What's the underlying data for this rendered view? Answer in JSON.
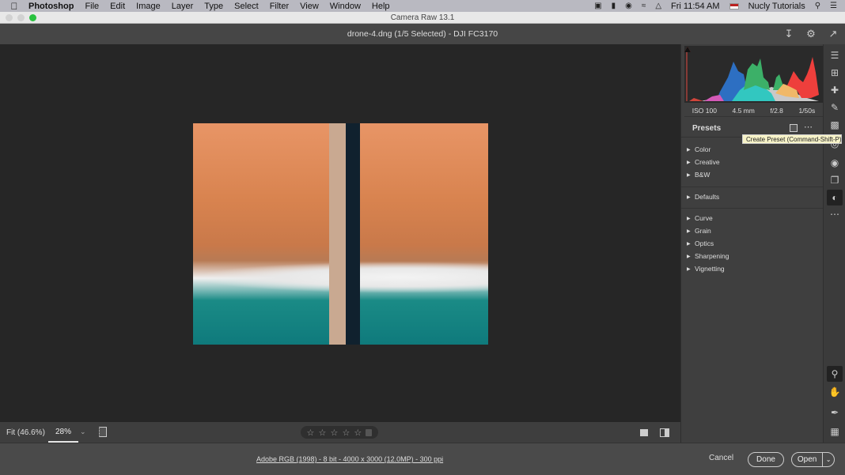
{
  "menubar": {
    "app": "Photoshop",
    "items": [
      "File",
      "Edit",
      "Image",
      "Layer",
      "Type",
      "Select",
      "Filter",
      "View",
      "Window",
      "Help"
    ],
    "clock": "Fri 11:54 AM",
    "user": "Nucly Tutorials"
  },
  "window": {
    "title": "Camera Raw 13.1"
  },
  "header": {
    "file_info": "drone-4.dng (1/5 Selected)  -  DJI FC3170"
  },
  "histogram": {
    "exif": [
      "ISO 100",
      "4.5 mm",
      "f/2.8",
      "1/50s"
    ]
  },
  "presets": {
    "title": "Presets",
    "tooltip": "Create Preset (Command-Shift-P)",
    "groups": [
      [
        "Color",
        "Creative",
        "B&W"
      ],
      [
        "Defaults"
      ],
      [
        "Curve",
        "Grain",
        "Optics",
        "Sharpening",
        "Vignetting"
      ]
    ]
  },
  "bottom": {
    "fit_label": "Fit (46.6%)",
    "zoom_value": "28%",
    "rating_stars": 0
  },
  "footer": {
    "info": "Adobe RGB (1998) - 8 bit - 4000 x 3000 (12.0MP) - 300 ppi",
    "cancel": "Cancel",
    "done": "Done",
    "open": "Open"
  }
}
